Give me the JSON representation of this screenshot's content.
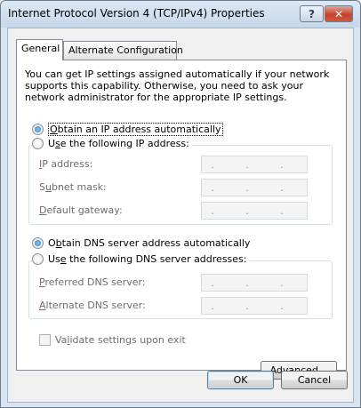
{
  "window": {
    "title": "Internet Protocol Version 4 (TCP/IPv4) Properties",
    "help_label": "?",
    "close_label": "✕"
  },
  "tabs": [
    {
      "label": "General",
      "active": true
    },
    {
      "label": "Alternate Configuration",
      "active": false
    }
  ],
  "intro_text": "You can get IP settings assigned automatically if your network supports this capability. Otherwise, you need to ask your network administrator for the appropriate IP settings.",
  "ip_section": {
    "auto": {
      "pre": "",
      "key": "O",
      "post": "btain an IP address automatically",
      "selected": true
    },
    "manual": {
      "pre": "U",
      "key": "s",
      "post": "e the following IP address:",
      "selected": false
    },
    "fields": [
      {
        "pre": "",
        "key": "I",
        "post": "P address:",
        "value": ". . ."
      },
      {
        "pre": "S",
        "key": "u",
        "post": "bnet mask:",
        "value": ". . ."
      },
      {
        "pre": "",
        "key": "D",
        "post": "efault gateway:",
        "value": ". . ."
      }
    ]
  },
  "dns_section": {
    "auto": {
      "pre": "O",
      "key": "b",
      "post": "tain DNS server address automatically",
      "selected": true
    },
    "manual": {
      "pre": "Us",
      "key": "e",
      "post": " the following DNS server addresses:",
      "selected": false
    },
    "fields": [
      {
        "pre": "",
        "key": "P",
        "post": "referred DNS server:",
        "value": ". . ."
      },
      {
        "pre": "",
        "key": "A",
        "post": "lternate DNS server:",
        "value": ". . ."
      }
    ]
  },
  "validate": {
    "pre": "Va",
    "key": "l",
    "post": "idate settings upon exit",
    "checked": false
  },
  "buttons": {
    "advanced": {
      "pre": "Ad",
      "key": "v",
      "post": "anced..."
    },
    "ok": "OK",
    "cancel": "Cancel"
  }
}
